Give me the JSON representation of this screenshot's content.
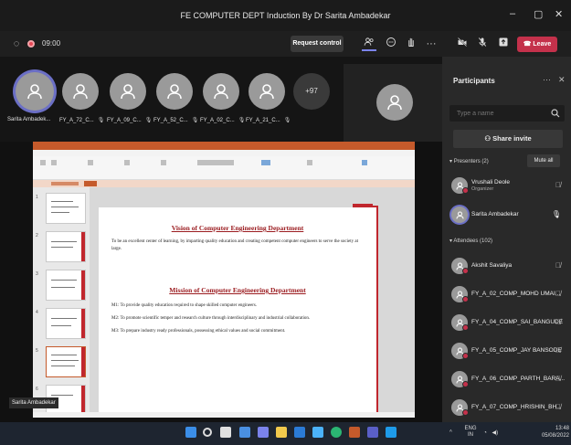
{
  "window": {
    "title": "FE COMPUTER DEPT Induction By Dr Sarita Ambadekar",
    "minimize": "–",
    "maximize": "▢",
    "close": "✕"
  },
  "toolbar": {
    "timer": "09:00",
    "request_control": "Request control",
    "more": "···",
    "leave": "Leave"
  },
  "gallery": {
    "participants": [
      {
        "name": "Sarita Ambadek...",
        "mic": ""
      },
      {
        "name": "FY_A_72_C...",
        "mic": "🎙"
      },
      {
        "name": "FY_A_09_C...",
        "mic": "🎙"
      },
      {
        "name": "FY_A_52_C...",
        "mic": "🎙"
      },
      {
        "name": "FY_A_02_C...",
        "mic": "🎙"
      },
      {
        "name": "FY_A_21_C...",
        "mic": "🎙"
      }
    ],
    "overflow_count": "+97"
  },
  "slide": {
    "vision_heading": "Vision of Computer Engineering Department",
    "vision_text": "To be an excellent center of learning, by imparting quality education and creating competent computer engineers to serve the society at large.",
    "mission_heading": "Mission of Computer Engineering Department",
    "m1": "M1: To provide quality education required to shape skilled computer engineers.",
    "m2": "M2: To promote scientific temper and research culture through interdisciplinary and industrial collaboration.",
    "m3": "M3: To prepare industry ready professionals, possessing ethical values and social commitment.",
    "thumb_numbers": [
      "1",
      "2",
      "3",
      "4",
      "5",
      "6"
    ],
    "presenter_label": "Sarita Ambadekar"
  },
  "panel": {
    "title": "Participants",
    "search_placeholder": "Type a name",
    "share_invite": "Share invite",
    "presenters_label": "Presenters (2)",
    "mute_all": "Mute all",
    "attendees_label": "Attendees (102)",
    "presenters": [
      {
        "name": "Vrushali Deole",
        "role": "Organizer"
      },
      {
        "name": "Sarita Ambadekar",
        "role": ""
      }
    ],
    "attendees": [
      {
        "name": "Akshit Savaliya"
      },
      {
        "name": "FY_A_02_COMP_MOHD UMAI..."
      },
      {
        "name": "FY_A_04_COMP_SAI_BANGUDE"
      },
      {
        "name": "FY_A_05_COMP_JAY BANSODE"
      },
      {
        "name": "FY_A_06_COMP_PARTH_BARA..."
      },
      {
        "name": "FY_A_07_COMP_HRISHIN_BH..."
      }
    ]
  },
  "taskbar": {
    "lang_top": "ENG",
    "lang_bottom": "IN",
    "time": "13:48",
    "date": "05/08/2022"
  }
}
